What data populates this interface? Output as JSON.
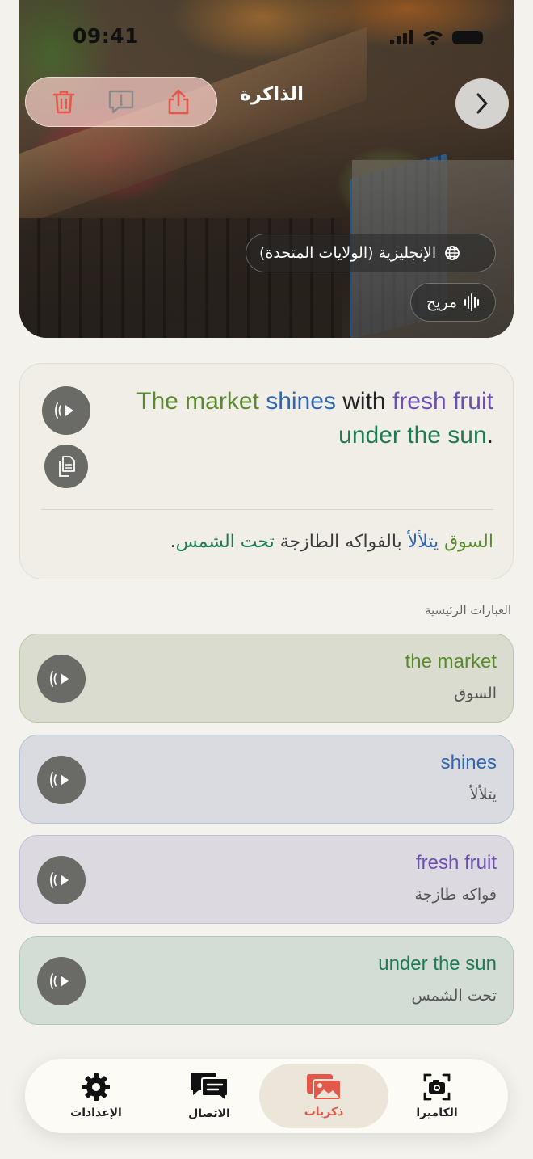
{
  "status_bar": {
    "time": "09:41"
  },
  "header": {
    "title": "الذاكرة",
    "actions": [
      {
        "name": "trash-icon",
        "color": "#e2584a"
      },
      {
        "name": "report-icon",
        "color": "#e2584a"
      },
      {
        "name": "share-icon",
        "color": "#e2584a"
      }
    ],
    "back_icon": "chevron-right-icon"
  },
  "hero": {
    "language": "الإنجليزية (الولايات المتحدة)",
    "language_icon": "globe-icon",
    "voice": "مريح",
    "voice_icon": "waveform-icon"
  },
  "translation": {
    "segments": [
      {
        "text": "The market",
        "color": "#5a8a2e"
      },
      {
        "text": " "
      },
      {
        "text": "shines",
        "color": "#2f66b0"
      },
      {
        "text": " with "
      },
      {
        "text": "fresh fruit",
        "color": "#6b4fb3"
      },
      {
        "text": " "
      },
      {
        "text": "under the sun",
        "color": "#1e7a52"
      },
      {
        "text": "."
      }
    ],
    "arabic_segments": [
      {
        "text": "السوق",
        "color": "#5a8a2e"
      },
      {
        "text": " "
      },
      {
        "text": "يتلألأ",
        "color": "#2f66b0"
      },
      {
        "text": " بالفواكه الطازجة "
      },
      {
        "text": "تحت الشمس",
        "color": "#1e7a52"
      },
      {
        "text": "."
      }
    ],
    "play_icon": "speaker-play-icon",
    "copy_icon": "copy-icon"
  },
  "key_phrases_label": "العبارات الرئيسية",
  "phrases": [
    {
      "en": "the market",
      "ar": "السوق",
      "color": "#5a8a2e",
      "bg": "#dadcd0",
      "border": "#bdc6a6"
    },
    {
      "en": "shines",
      "ar": "يتلألأ",
      "color": "#2f66b0",
      "bg": "#d9dbe0",
      "border": "#b4c0d8"
    },
    {
      "en": "fresh fruit",
      "ar": "فواكه طازجة",
      "color": "#6b4fb3",
      "bg": "#dcd9e1",
      "border": "#c4bcd9"
    },
    {
      "en": "under the sun",
      "ar": "تحت الشمس",
      "color": "#1e7a52",
      "bg": "#d3ddd6",
      "border": "#aecab8"
    }
  ],
  "tabs": [
    {
      "label": "الإعدادات",
      "icon": "gear-icon",
      "active": false
    },
    {
      "label": "الاتصال",
      "icon": "chat-icon",
      "active": false
    },
    {
      "label": "ذكريات",
      "icon": "photos-icon",
      "active": true
    },
    {
      "label": "الكاميرا",
      "icon": "camera-icon",
      "active": false
    }
  ]
}
